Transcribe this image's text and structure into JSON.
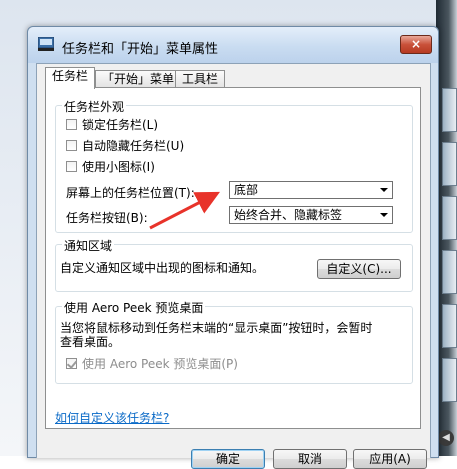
{
  "window": {
    "title": "任务栏和「开始」菜单属性",
    "close_symbol": "×"
  },
  "tabs": [
    {
      "label": "任务栏",
      "active": true
    },
    {
      "label": "「开始」菜单",
      "active": false
    },
    {
      "label": "工具栏",
      "active": false
    }
  ],
  "appearance": {
    "title": "任务栏外观",
    "lock_label": "锁定任务栏(L)",
    "lock_checked": false,
    "autohide_label": "自动隐藏任务栏(U)",
    "autohide_checked": false,
    "small_icons_label": "使用小图标(I)",
    "small_icons_checked": false,
    "location_label": "屏幕上的任务栏位置(T):",
    "location_value": "底部",
    "buttons_label": "任务栏按钮(B):",
    "buttons_value": "始终合并、隐藏标签"
  },
  "notification": {
    "title": "通知区域",
    "desc": "自定义通知区域中出现的图标和通知。",
    "customize_button": "自定义(C)..."
  },
  "aero_peek": {
    "title": "使用 Aero Peek 预览桌面",
    "desc_line1": "当您将鼠标移动到任务栏末端的“显示桌面”按钮时，会暂时",
    "desc_line2": "查看桌面。",
    "checkbox_label": "使用 Aero Peek 预览桌面(P)",
    "checkbox_checked": true
  },
  "help_link": "如何自定义该任务栏?",
  "footer": {
    "ok": "确定",
    "cancel": "取消",
    "apply": "应用(A)"
  },
  "colors": {
    "accent_arrow": "#e8332a",
    "link": "#0a6ac7",
    "close_button": "#c9513a"
  }
}
